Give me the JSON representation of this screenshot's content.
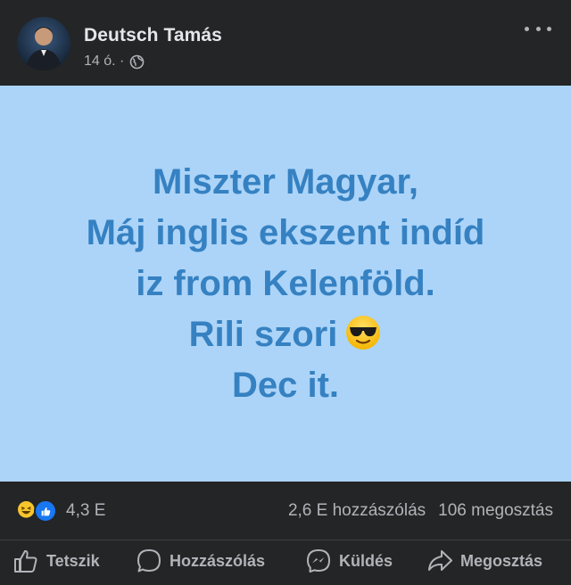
{
  "post": {
    "author": "Deutsch Tamás",
    "time": "14 ó. ·",
    "lines": [
      "Miszter Magyar,",
      "Máj inglis ekszent indíd",
      "iz from Kelenföld.",
      "Rili szori",
      "Dec it."
    ],
    "background_color": "#acd4f8",
    "text_color": "#3581c2"
  },
  "stats": {
    "reaction_count": "4,3 E",
    "comments": "2,6 E hozzászólás",
    "shares": "106 megosztás"
  },
  "actions": {
    "like": "Tetszik",
    "comment": "Hozzászólás",
    "send": "Küldés",
    "share": "Megosztás"
  },
  "icons": {
    "more": "more-dots-icon",
    "audience": "globe-icon",
    "emoji": "sunglasses-emoji-icon"
  }
}
